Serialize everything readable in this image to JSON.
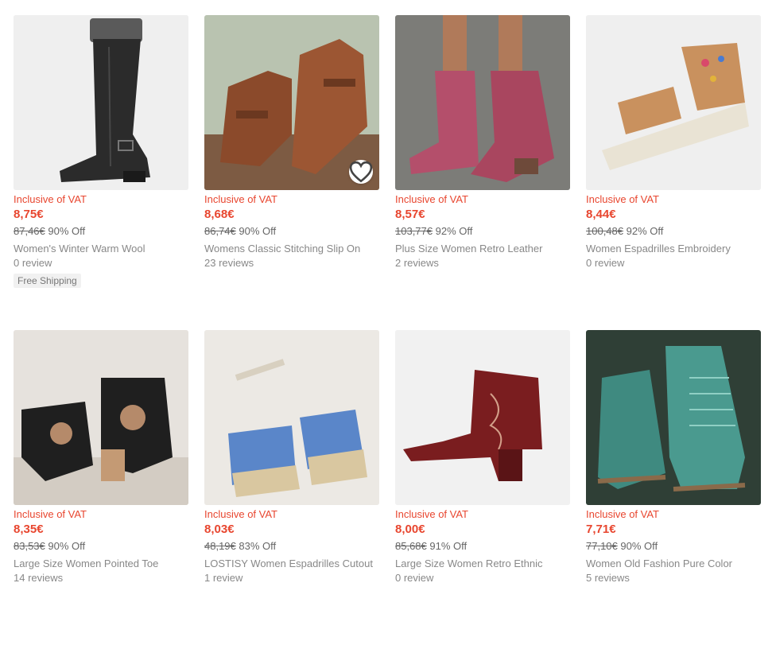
{
  "products": [
    {
      "vat": "Inclusive of VAT",
      "price": "8,75€",
      "original": "87,46€",
      "discount": "90% Off",
      "title": "Women's Winter Warm Wool",
      "reviews": "0 review",
      "shipping": "Free Shipping",
      "bg": "#efefef",
      "shoe": "#2b2b2b"
    },
    {
      "vat": "Inclusive of VAT",
      "price": "8,68€",
      "original": "86,74€",
      "discount": "90% Off",
      "title": "Womens Classic Stitching Slip On",
      "reviews": "23 reviews",
      "bg": "#b9c3b0",
      "shoe": "#8b4a2b",
      "wishlist": "heart-icon"
    },
    {
      "vat": "Inclusive of VAT",
      "price": "8,57€",
      "original": "103,77€",
      "discount": "92% Off",
      "title": "Plus Size Women Retro Leather",
      "reviews": "2 reviews",
      "bg": "#7c7c78",
      "shoe": "#b44f6b"
    },
    {
      "vat": "Inclusive of VAT",
      "price": "8,44€",
      "original": "100,48€",
      "discount": "92% Off",
      "title": "Women Espadrilles Embroidery",
      "reviews": "0 review",
      "bg": "#efefef",
      "shoe": "#c9915e"
    },
    {
      "vat": "Inclusive of VAT",
      "price": "8,35€",
      "original": "83,53€",
      "discount": "90% Off",
      "title": "Large Size Women Pointed Toe",
      "reviews": "14 reviews",
      "bg": "#e6e2dd",
      "shoe": "#1f1f1f"
    },
    {
      "vat": "Inclusive of VAT",
      "price": "8,03€",
      "original": "48,19€",
      "discount": "83% Off",
      "title": "LOSTISY Women Espadrilles Cutout",
      "reviews": "1 review",
      "bg": "#ece9e4",
      "shoe": "#5a86c9"
    },
    {
      "vat": "Inclusive of VAT",
      "price": "8,00€",
      "original": "85,68€",
      "discount": "91% Off",
      "title": "Large Size Women Retro Ethnic",
      "reviews": "0 review",
      "bg": "#f1f1f1",
      "shoe": "#7a1d1f"
    },
    {
      "vat": "Inclusive of VAT",
      "price": "7,71€",
      "original": "77,10€",
      "discount": "90% Off",
      "title": "Women Old Fashion Pure Color",
      "reviews": "5 reviews",
      "bg": "#2f3f36",
      "shoe": "#3f8a80"
    }
  ]
}
